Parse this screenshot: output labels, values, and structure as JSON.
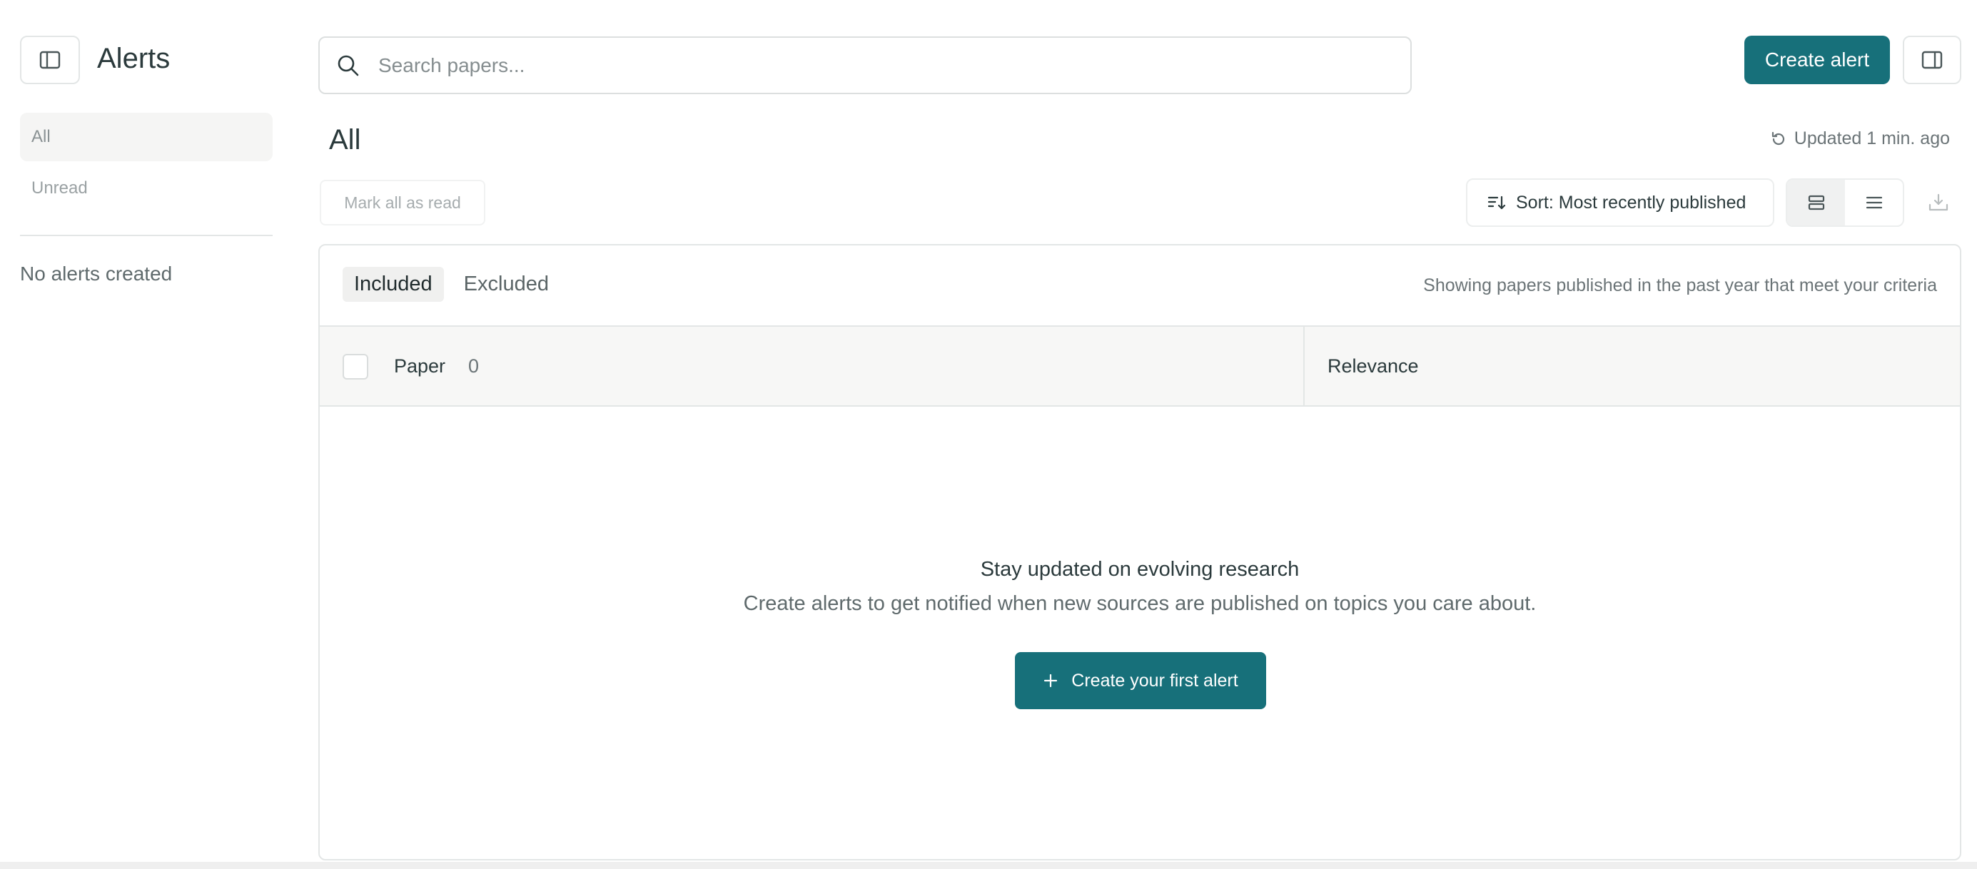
{
  "sidebar": {
    "title": "Alerts",
    "nav": [
      {
        "label": "All",
        "active": true
      },
      {
        "label": "Unread",
        "active": false
      }
    ],
    "empty_text": "No alerts created",
    "toggle_icon": "sidebar-toggle-icon"
  },
  "header": {
    "search_placeholder": "Search papers...",
    "create_alert_label": "Create alert",
    "panel_icon": "panel-right-icon"
  },
  "page": {
    "title": "All",
    "updated_text": "Updated 1 min. ago"
  },
  "toolbar": {
    "mark_all_read": "Mark all as read",
    "sort_label": "Sort: Most recently published",
    "views": [
      "card-view-icon",
      "list-view-icon"
    ],
    "download_icon": "download-icon"
  },
  "panel": {
    "tabs": [
      {
        "label": "Included",
        "active": true
      },
      {
        "label": "Excluded",
        "active": false
      }
    ],
    "criteria_text": "Showing papers published in the past year that meet your criteria",
    "columns": {
      "paper": "Paper",
      "paper_count": "0",
      "relevance": "Relevance"
    },
    "empty_state": {
      "title": "Stay updated on evolving research",
      "subtitle": "Create alerts to get notified when new sources are published on topics you care about.",
      "button_label": "Create your first alert"
    }
  },
  "colors": {
    "accent": "#17707a",
    "text": "#2b3a3c",
    "muted": "#6b7477",
    "border": "#e3e6e6"
  }
}
